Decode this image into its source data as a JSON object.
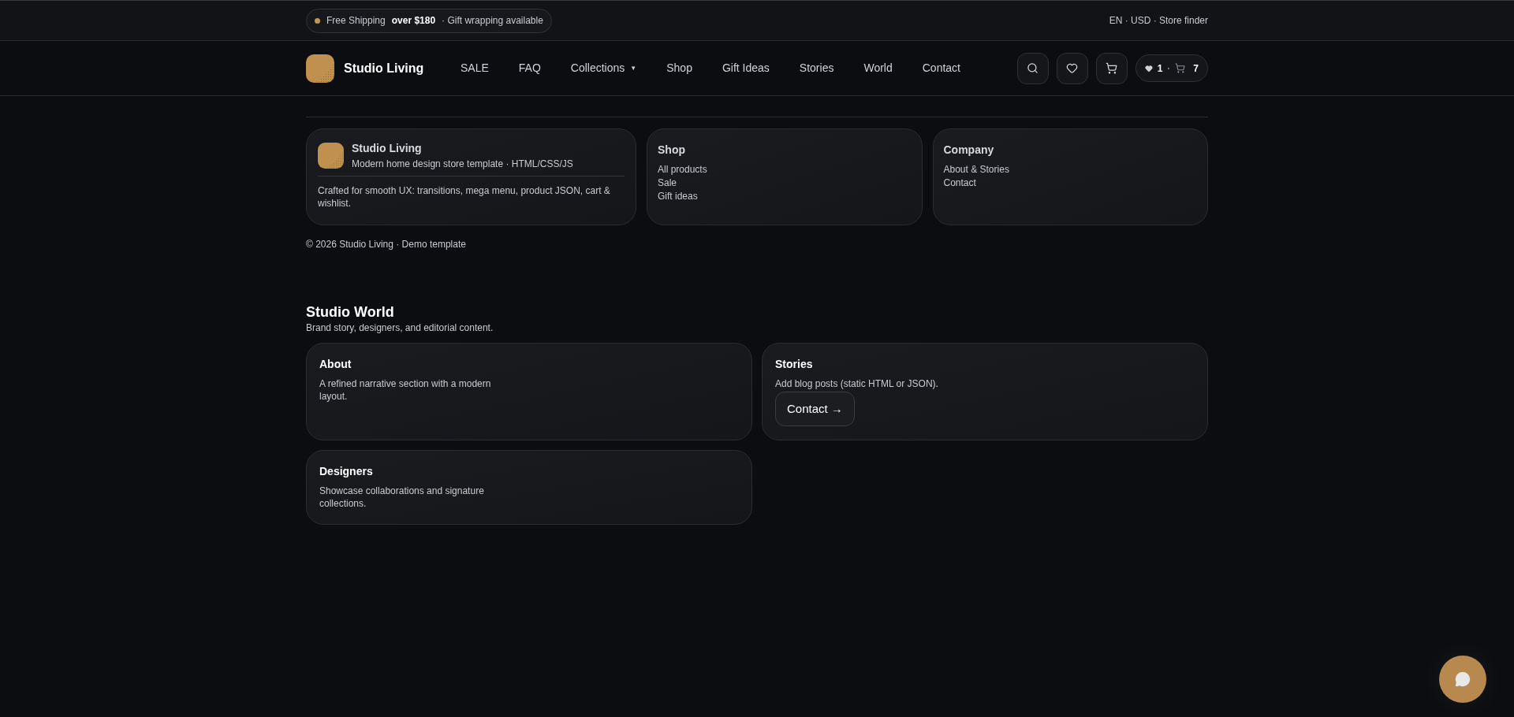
{
  "announcement": {
    "prefix": "Free Shipping",
    "highlight": "over $180",
    "suffix": "· Gift wrapping available"
  },
  "top_links": "EN · USD · Store finder",
  "brand": {
    "name": "Studio Living"
  },
  "nav": [
    {
      "label": "SALE",
      "has_menu": false
    },
    {
      "label": "FAQ",
      "has_menu": false
    },
    {
      "label": "Collections",
      "has_menu": true,
      "caret": "▼"
    },
    {
      "label": "Shop",
      "has_menu": false
    },
    {
      "label": "Gift Ideas",
      "has_menu": false
    },
    {
      "label": "Stories",
      "has_menu": false
    },
    {
      "label": "World",
      "has_menu": false
    },
    {
      "label": "Contact",
      "has_menu": false
    }
  ],
  "counter": {
    "wishlist": "1",
    "separator": "·",
    "cart": "7"
  },
  "footer": {
    "brand": {
      "name": "Studio Living",
      "tagline": "Modern home design store template · HTML/CSS/JS",
      "description": "Crafted for smooth UX: transitions, mega menu, product JSON, cart & wishlist."
    },
    "columns": [
      {
        "title": "Shop",
        "links": [
          "All products",
          "Sale",
          "Gift ideas"
        ]
      },
      {
        "title": "Company",
        "links": [
          "About & Stories",
          "Contact"
        ]
      }
    ],
    "copyright": "© 2026 Studio Living · Demo template"
  },
  "world": {
    "title": "Studio World",
    "subtitle": "Brand story, designers, and editorial content.",
    "cards": [
      {
        "title": "About",
        "text": "A refined narrative section with a modern layout."
      },
      {
        "title": "Stories",
        "text": "Add blog posts (static HTML or JSON).",
        "button": "Contact →"
      },
      {
        "title": "Designers",
        "text": "Showcase collaborations and signature collections."
      }
    ]
  }
}
